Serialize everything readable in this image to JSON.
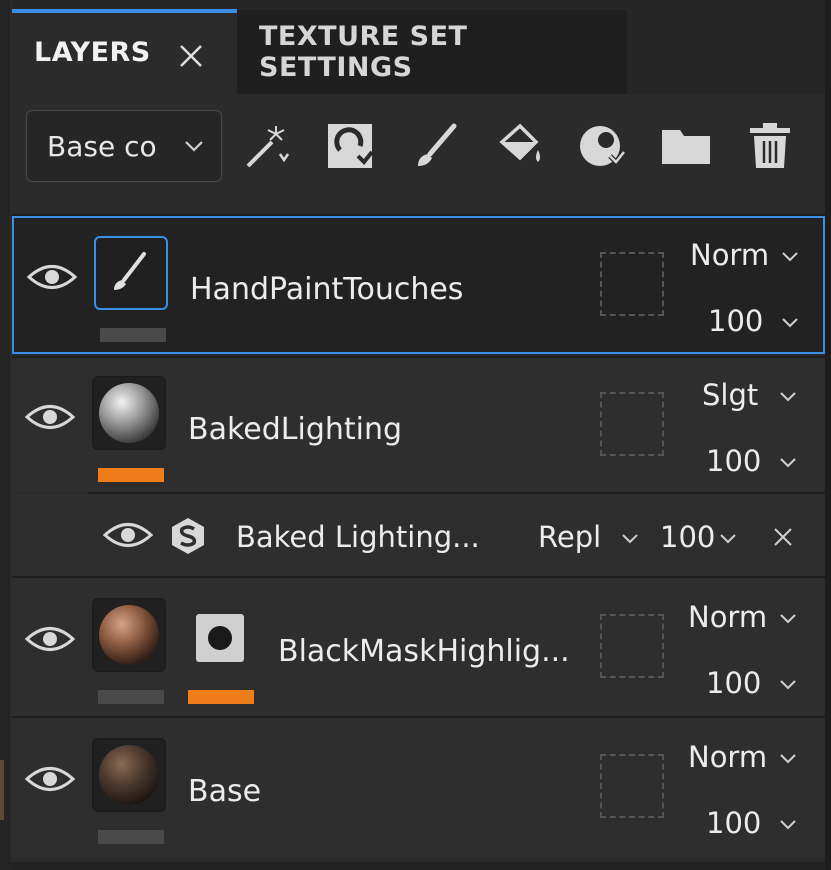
{
  "tabs": {
    "layers_label": "LAYERS",
    "texture_set_label": "TEXTURE SET SETTINGS"
  },
  "toolbar": {
    "channel_value": "Base co",
    "tools": [
      "magic-wand-icon",
      "fill-layer-icon",
      "paint-brush-icon",
      "paint-bucket-icon",
      "mask-icon",
      "folder-icon",
      "trash-icon"
    ]
  },
  "layers": [
    {
      "name": "HandPaintTouches",
      "blend": "Norm",
      "opacity": "100"
    },
    {
      "name": "BakedLighting",
      "blend": "Slgt",
      "opacity": "100"
    },
    {
      "name": "BlackMaskHighlig...",
      "blend": "Norm",
      "opacity": "100"
    },
    {
      "name": "Base",
      "blend": "Norm",
      "opacity": "100"
    }
  ],
  "effect": {
    "name": "Baked Lighting...",
    "blend": "Repl",
    "opacity": "100"
  },
  "colors": {
    "accent_blue": "#3a8ee6",
    "highlight_orange": "#ef7d19",
    "panel_bg": "#2b2b2b"
  }
}
